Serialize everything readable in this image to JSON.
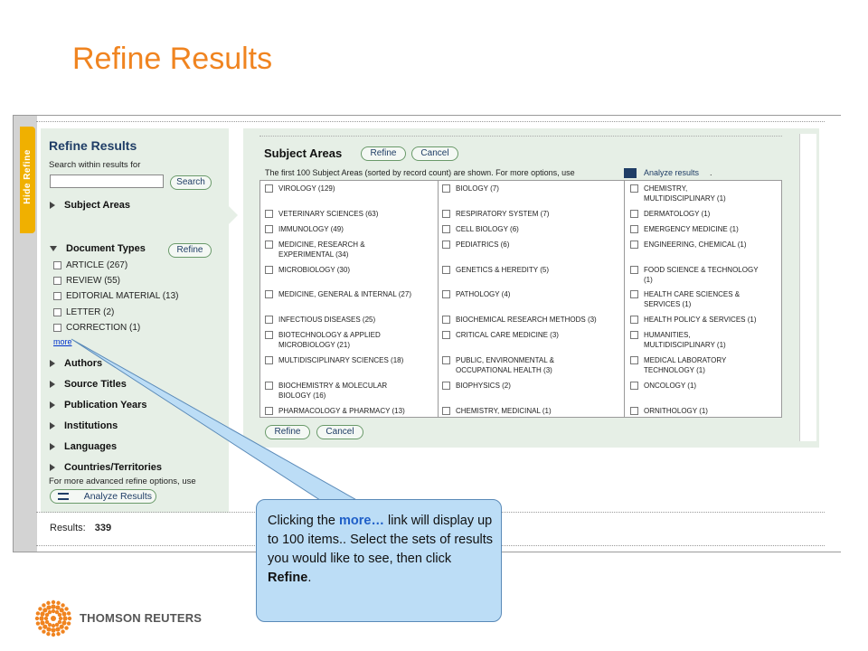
{
  "slide_title": "Refine Results",
  "hide_tab_label": "Hide Refine",
  "left_panel": {
    "title": "Refine Results",
    "search_label": "Search within results for",
    "search_button": "Search",
    "sections": {
      "subject_areas": "Subject Areas",
      "document_types": "Document Types",
      "authors": "Authors",
      "source_titles": "Source Titles",
      "publication_years": "Publication Years",
      "institutions": "Institutions",
      "languages": "Languages",
      "countries": "Countries/Territories"
    },
    "doc_refine_button": "Refine",
    "doc_types": [
      "ARTICLE (267)",
      "REVIEW (55)",
      "EDITORIAL MATERIAL (13)",
      "LETTER (2)",
      "CORRECTION (1)"
    ],
    "more_link": "more",
    "advanced_note": "For more advanced refine options, use",
    "analyze_button": "Analyze Results"
  },
  "right_panel": {
    "title": "Subject Areas",
    "refine_button": "Refine",
    "cancel_button": "Cancel",
    "note": "The first 100 Subject Areas (sorted by record count) are shown. For more options, use",
    "analyze_link": "Analyze results",
    "note_end": ".",
    "col1": [
      "VIROLOGY (129)",
      "VETERINARY SCIENCES (63)",
      "IMMUNOLOGY (49)",
      "MEDICINE, RESEARCH &|EXPERIMENTAL (34)",
      "MICROBIOLOGY (30)",
      "MEDICINE, GENERAL & INTERNAL (27)",
      "INFECTIOUS DISEASES (25)",
      "BIOTECHNOLOGY & APPLIED|MICROBIOLOGY (21)",
      "MULTIDISCIPLINARY SCIENCES (18)",
      "BIOCHEMISTRY & MOLECULAR|BIOLOGY (16)",
      "PHARMACOLOGY & PHARMACY (13)"
    ],
    "col2": [
      "BIOLOGY (7)",
      "RESPIRATORY SYSTEM (7)",
      "CELL BIOLOGY (6)",
      "PEDIATRICS (6)",
      "GENETICS & HEREDITY (5)",
      "PATHOLOGY (4)",
      "BIOCHEMICAL RESEARCH METHODS (3)",
      "CRITICAL CARE MEDICINE (3)",
      "PUBLIC, ENVIRONMENTAL &|OCCUPATIONAL HEALTH (3)",
      "BIOPHYSICS (2)",
      "CHEMISTRY, MEDICINAL (1)"
    ],
    "col3": [
      "CHEMISTRY,|MULTIDISCIPLINARY (1)",
      "DERMATOLOGY (1)",
      "EMERGENCY MEDICINE (1)",
      "ENGINEERING, CHEMICAL (1)",
      "FOOD SCIENCE & TECHNOLOGY|(1)",
      "HEALTH CARE SCIENCES &|SERVICES (1)",
      "HEALTH POLICY & SERVICES (1)",
      "HUMANITIES,|MULTIDISCIPLINARY (1)",
      "MEDICAL LABORATORY|TECHNOLOGY (1)",
      "ONCOLOGY (1)",
      "ORNITHOLOGY (1)"
    ],
    "bottom_refine": "Refine",
    "bottom_cancel": "Cancel"
  },
  "results": {
    "label": "Results:",
    "count": "339"
  },
  "callout": {
    "pre": "Clicking the ",
    "more": "more…",
    "mid": " link will display up to 100 items.. Select the sets of results you would like to see, then click ",
    "refine": "Refine",
    "end": "."
  },
  "logo_text": "THOMSON REUTERS",
  "colors": {
    "title": "#F08420",
    "panel_bg": "#E6EFE6",
    "tab": "#F0B000",
    "link": "#1F3D66",
    "callout_bg": "#BCDDF6"
  }
}
